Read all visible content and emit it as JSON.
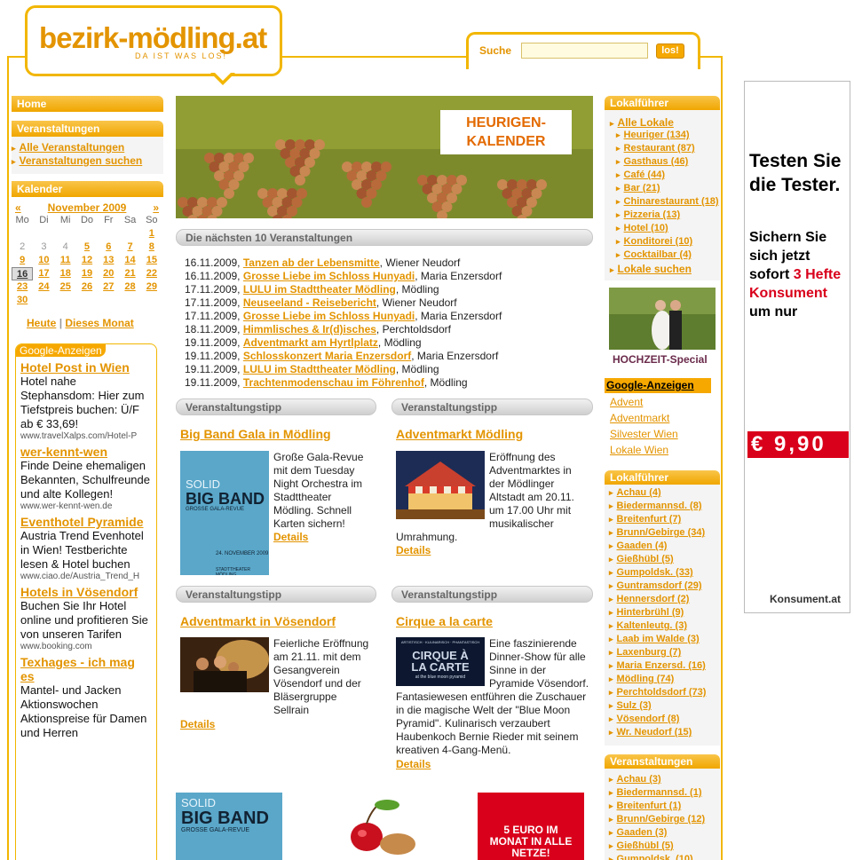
{
  "header": {
    "logo_text": "bezirk-mödling.at",
    "logo_sub": "DA IST WAS LOS!",
    "search_label": "Suche",
    "search_button": "los!",
    "search_value": ""
  },
  "left_nav": {
    "home": "Home",
    "veranstaltungen_title": "Veranstaltungen",
    "links": [
      "Alle Veranstaltungen",
      "Veranstaltungen suchen"
    ],
    "kalender_title": "Kalender"
  },
  "calendar": {
    "prev": "«",
    "next": "»",
    "month": "November 2009",
    "weekdays": [
      "Mo",
      "Di",
      "Mi",
      "Do",
      "Fr",
      "Sa",
      "So"
    ],
    "rows": [
      [
        {
          "v": ""
        },
        {
          "v": ""
        },
        {
          "v": ""
        },
        {
          "v": ""
        },
        {
          "v": ""
        },
        {
          "v": ""
        },
        {
          "v": "1",
          "s": "l"
        }
      ],
      [
        {
          "v": "2",
          "s": "g"
        },
        {
          "v": "3",
          "s": "g"
        },
        {
          "v": "4",
          "s": "g"
        },
        {
          "v": "5",
          "s": "l"
        },
        {
          "v": "6",
          "s": "l"
        },
        {
          "v": "7",
          "s": "l"
        },
        {
          "v": "8",
          "s": "l"
        }
      ],
      [
        {
          "v": "9",
          "s": "l"
        },
        {
          "v": "10",
          "s": "l"
        },
        {
          "v": "11",
          "s": "l"
        },
        {
          "v": "12",
          "s": "l"
        },
        {
          "v": "13",
          "s": "l"
        },
        {
          "v": "14",
          "s": "l"
        },
        {
          "v": "15",
          "s": "l"
        }
      ],
      [
        {
          "v": "16",
          "s": "t"
        },
        {
          "v": "17",
          "s": "l"
        },
        {
          "v": "18",
          "s": "l"
        },
        {
          "v": "19",
          "s": "l"
        },
        {
          "v": "20",
          "s": "l"
        },
        {
          "v": "21",
          "s": "l"
        },
        {
          "v": "22",
          "s": "l"
        }
      ],
      [
        {
          "v": "23",
          "s": "l"
        },
        {
          "v": "24",
          "s": "l"
        },
        {
          "v": "25",
          "s": "l"
        },
        {
          "v": "26",
          "s": "l"
        },
        {
          "v": "27",
          "s": "l"
        },
        {
          "v": "28",
          "s": "l"
        },
        {
          "v": "29",
          "s": "l"
        }
      ],
      [
        {
          "v": "30",
          "s": "l"
        },
        {
          "v": ""
        },
        {
          "v": ""
        },
        {
          "v": ""
        },
        {
          "v": ""
        },
        {
          "v": ""
        },
        {
          "v": ""
        }
      ]
    ],
    "today": "Heute",
    "sep": "|",
    "this_month": "Dieses Monat"
  },
  "google_ads": {
    "title": "Google-Anzeigen",
    "ads": [
      {
        "title": "Hotel Post in Wien",
        "text": "Hotel nahe Stephansdom: Hier zum Tiefstpreis buchen: Ü/F ab € 33,69!",
        "url": "www.travelXalps.com/Hotel-P"
      },
      {
        "title": "wer-kennt-wen",
        "text": "Finde Deine ehemaligen Bekannten, Schulfreunde und alte Kollegen!",
        "url": "www.wer-kennt-wen.de"
      },
      {
        "title": "Eventhotel Pyramide",
        "text": "Austria Trend Evenhotel in Wien! Testberichte lesen & Hotel buchen",
        "url": "www.ciao.de/Austria_Trend_H"
      },
      {
        "title": "Hotels in Vösendorf",
        "text": "Buchen Sie Ihr Hotel online und profitieren Sie von unseren Tarifen",
        "url": "www.booking.com"
      },
      {
        "title": "Texhages - ich mag es",
        "text": "Mantel- und Jacken Aktionswochen Aktionspreise für Damen und Herren",
        "url": ""
      }
    ]
  },
  "banner": {
    "label": "HEURIGEN-\nKALENDER"
  },
  "events": {
    "title": "Die nächsten 10 Veranstaltungen",
    "items": [
      {
        "date": "16.11.2009,",
        "name": "Tanzen ab der Lebensmitte",
        "place": ", Wiener Neudorf"
      },
      {
        "date": "16.11.2009,",
        "name": "Grosse Liebe im Schloss Hunyadi",
        "place": ", Maria Enzersdorf"
      },
      {
        "date": "17.11.2009,",
        "name": "LULU im Stadttheater Mödling",
        "place": ", Mödling"
      },
      {
        "date": "17.11.2009,",
        "name": "Neuseeland - Reisebericht",
        "place": ", Wiener Neudorf"
      },
      {
        "date": "17.11.2009,",
        "name": "Grosse Liebe im Schloss Hunyadi",
        "place": ", Maria Enzersdorf"
      },
      {
        "date": "18.11.2009,",
        "name": "Himmlisches & Ir(d)isches",
        "place": ", Perchtoldsdorf"
      },
      {
        "date": "19.11.2009,",
        "name": "Adventmarkt am Hyrtlplatz",
        "place": ", Mödling"
      },
      {
        "date": "19.11.2009,",
        "name": "Schlosskonzert Maria Enzersdorf",
        "place": ", Maria Enzersdorf"
      },
      {
        "date": "19.11.2009,",
        "name": "LULU im Stadttheater Mödling",
        "place": ", Mödling"
      },
      {
        "date": "19.11.2009,",
        "name": "Trachtenmodenschau im Föhrenhof",
        "place": ", Mödling"
      }
    ]
  },
  "tips": {
    "header": "Veranstaltungstipp",
    "details": "Details",
    "items": [
      {
        "title": "Big Band Gala in Mödling",
        "text": "Große Gala-Revue mit dem Tuesday Night Orchestra im Stadttheater Mödling. Schnell Karten sichern!",
        "img_top": "SOLID",
        "img_main": "BIG BAND",
        "img_sub": "GROSSE GALA-REVUE",
        "img_date": "24. NOVEMBER 2009",
        "img_venue": "STADTTHEATER MÖDLING"
      },
      {
        "title": "Adventmarkt Mödling",
        "text": "Eröffnung des Adventmarktes in der Mödlinger Altstadt am 20.11. um 17.00 Uhr mit musikalischer Umrahmung."
      },
      {
        "title": "Adventmarkt in Vösendorf",
        "text": "Feierliche Eröffnung am 21.11. mit dem Gesangverein Vösendorf und der Bläsergruppe Sellrain"
      },
      {
        "title": "Cirque a la carte",
        "text": "Eine faszinierende Dinner-Show für alle Sinne in der Pyramide Vösendorf. Fantasiewesen entführen die Zuschauer in die magische Welt der \"Blue Moon Pyramid\". Kulinarisch verzaubert Haubenkoch Bernie Rieder mit seinem kreativen 4-Gang-Menü.",
        "img_top": "ARTISTISCH · KULINARISCH · PHANTASTISCH",
        "img_main": "CIRQUE À LA CARTE",
        "img_sub": "at the blue moon pyramid"
      }
    ]
  },
  "bottom_promos": {
    "solid": "SOLID",
    "bigband": "BIG BAND",
    "gala": "GROSSE GALA-REVUE",
    "netze": "5 EURO IM MONAT IN ALLE NETZE!"
  },
  "right": {
    "lokalfuehrer_title": "Lokalführer",
    "alle_lokale": "Alle Lokale",
    "categories": [
      "Heuriger (134)",
      "Restaurant (87)",
      "Gasthaus (46)",
      "Café (44)",
      "Bar (21)",
      "Chinarestaurant (18)",
      "Pizzeria (13)",
      "Hotel (10)",
      "Konditorei (10)",
      "Cocktailbar (4)"
    ],
    "lokale_suchen": "Lokale suchen",
    "hochzeit": "HOCHZEIT-Special",
    "google_title": "Google-Anzeigen",
    "google_links": [
      "Advent",
      "Adventmarkt",
      "Silvester Wien",
      "Lokale Wien"
    ],
    "orte_title": "Lokalführer",
    "orte": [
      "Achau (4)",
      "Biedermannsd. (8)",
      "Breitenfurt (7)",
      "Brunn/Gebirge (34)",
      "Gaaden (4)",
      "Gießhübl (5)",
      "Gumpoldsk. (33)",
      "Guntramsdorf (29)",
      "Hennersdorf (2)",
      "Hinterbrühl (9)",
      "Kaltenleutg. (3)",
      "Laab im Walde (3)",
      "Laxenburg (7)",
      "Maria Enzersd. (16)",
      "Mödling (74)",
      "Perchtoldsdorf (73)",
      "Sulz (3)",
      "Vösendorf (8)",
      "Wr. Neudorf (15)"
    ],
    "veranst_title": "Veranstaltungen",
    "veranst_orte": [
      "Achau (3)",
      "Biedermannsd. (1)",
      "Breitenfurt (1)",
      "Brunn/Gebirge (12)",
      "Gaaden (3)",
      "Gießhübl (5)",
      "Gumpoldsk. (10)"
    ]
  },
  "ad": {
    "headline": "Testen Sie die Tester.",
    "line1": "Sichern Sie sich jetzt sofort ",
    "red1": "3 Hefte Konsument",
    "line2": " um nur",
    "price": "€ 9,90",
    "brand": "Konsument.at"
  },
  "colors": {
    "accent": "#e39400",
    "border": "#f2b600",
    "red": "#d9001b"
  }
}
